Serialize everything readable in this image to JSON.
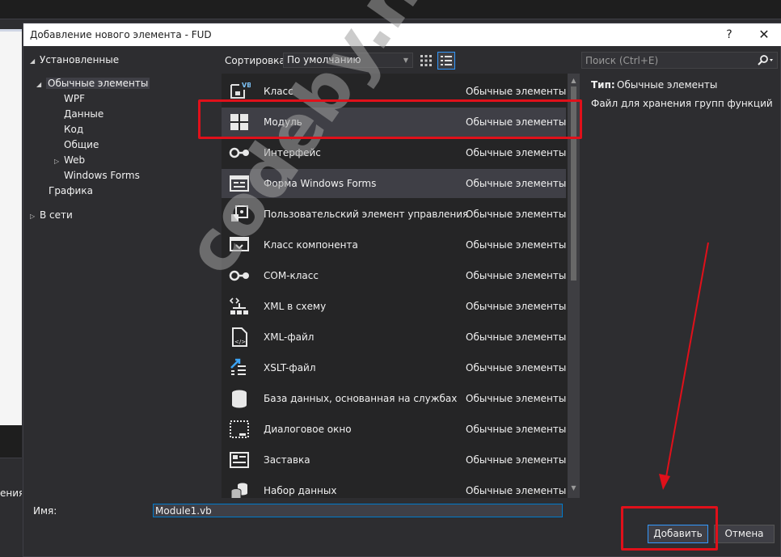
{
  "background": {
    "left_label": "ения"
  },
  "dialog": {
    "title": "Добавление нового элемента  - FUD",
    "help": "?",
    "close": "✕"
  },
  "tree": {
    "installed": "Установленные",
    "common_items": "Обычные элементы",
    "children": [
      "WPF",
      "Данные",
      "Код",
      "Общие",
      "Web",
      "Windows Forms"
    ],
    "graphics": "Графика",
    "online": "В сети"
  },
  "sort": {
    "label": "Сортировка:",
    "value": "По умолчанию"
  },
  "items": [
    {
      "name": "Класс",
      "category": "Обычные элементы",
      "icon": "vb-class-icon"
    },
    {
      "name": "Модуль",
      "category": "Обычные элементы",
      "icon": "module-icon"
    },
    {
      "name": "Интерфейс",
      "category": "Обычные элементы",
      "icon": "interface-icon"
    },
    {
      "name": "Форма Windows Forms",
      "category": "Обычные элементы",
      "icon": "windows-form-icon"
    },
    {
      "name": "Пользовательский элемент управления",
      "category": "Обычные элементы",
      "icon": "user-control-icon"
    },
    {
      "name": "Класс компонента",
      "category": "Обычные элементы",
      "icon": "component-class-icon"
    },
    {
      "name": "COM-класс",
      "category": "Обычные элементы",
      "icon": "com-class-icon"
    },
    {
      "name": "XML в схему",
      "category": "Обычные элементы",
      "icon": "xml-schema-icon"
    },
    {
      "name": "XML-файл",
      "category": "Обычные элементы",
      "icon": "xml-file-icon"
    },
    {
      "name": "XSLT-файл",
      "category": "Обычные элементы",
      "icon": "xslt-file-icon"
    },
    {
      "name": "База данных, основанная на службах",
      "category": "Обычные элементы",
      "icon": "database-icon"
    },
    {
      "name": "Диалоговое окно",
      "category": "Обычные элементы",
      "icon": "dialog-icon"
    },
    {
      "name": "Заставка",
      "category": "Обычные элементы",
      "icon": "splash-screen-icon"
    },
    {
      "name": "Набор данных",
      "category": "Обычные элементы",
      "icon": "dataset-icon"
    }
  ],
  "search": {
    "placeholder": "Поиск (Ctrl+E)"
  },
  "details": {
    "type_label": "Тип:",
    "type_value": "Обычные элементы",
    "description": "Файл для хранения групп функций"
  },
  "name_field": {
    "label": "Имя:",
    "value": "Module1.vb"
  },
  "buttons": {
    "add": "Добавить",
    "cancel": "Отмена"
  },
  "watermark": "codeby.net",
  "colors": {
    "accent": "#007acc",
    "selection": "#3f3f46",
    "annotation": "#e0101a"
  }
}
